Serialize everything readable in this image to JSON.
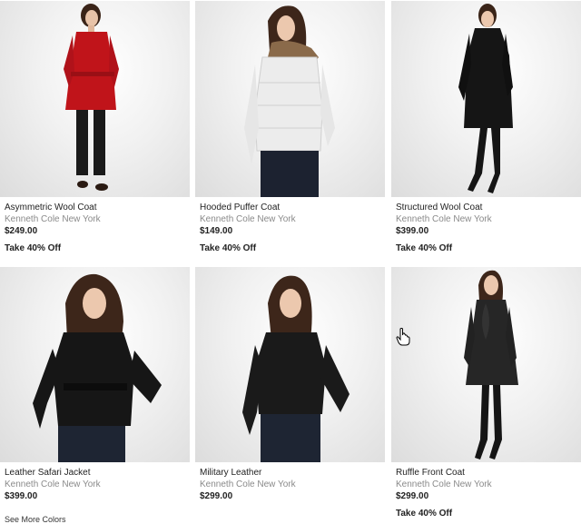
{
  "products": [
    {
      "name": "Asymmetric Wool Coat",
      "brand": "Kenneth Cole New York",
      "price": "$249.00",
      "promo": "Take 40% Off",
      "coat_color": "#c0141a",
      "pants_color": "#1a1a1a"
    },
    {
      "name": "Hooded Puffer Coat",
      "brand": "Kenneth Cole New York",
      "price": "$149.00",
      "promo": "Take 40% Off",
      "coat_color": "#ececec",
      "pants_color": "#1c2230"
    },
    {
      "name": "Structured Wool Coat",
      "brand": "Kenneth Cole New York",
      "price": "$399.00",
      "promo": "Take 40% Off",
      "coat_color": "#151515",
      "pants_color": "#151515"
    },
    {
      "name": "Leather Safari Jacket",
      "brand": "Kenneth Cole New York",
      "price": "$399.00",
      "link": "See More Colors",
      "coat_color": "#161616",
      "pants_color": "#1e2533"
    },
    {
      "name": "Military Leather",
      "brand": "Kenneth Cole New York",
      "price": "$299.00",
      "coat_color": "#1a1a1a",
      "pants_color": "#1e2533"
    },
    {
      "name": "Ruffle Front Coat",
      "brand": "Kenneth Cole New York",
      "price": "$299.00",
      "promo": "Take 40% Off",
      "coat_color": "#262626",
      "pants_color": "#151515"
    }
  ],
  "cursor": "hand-pointer-icon"
}
